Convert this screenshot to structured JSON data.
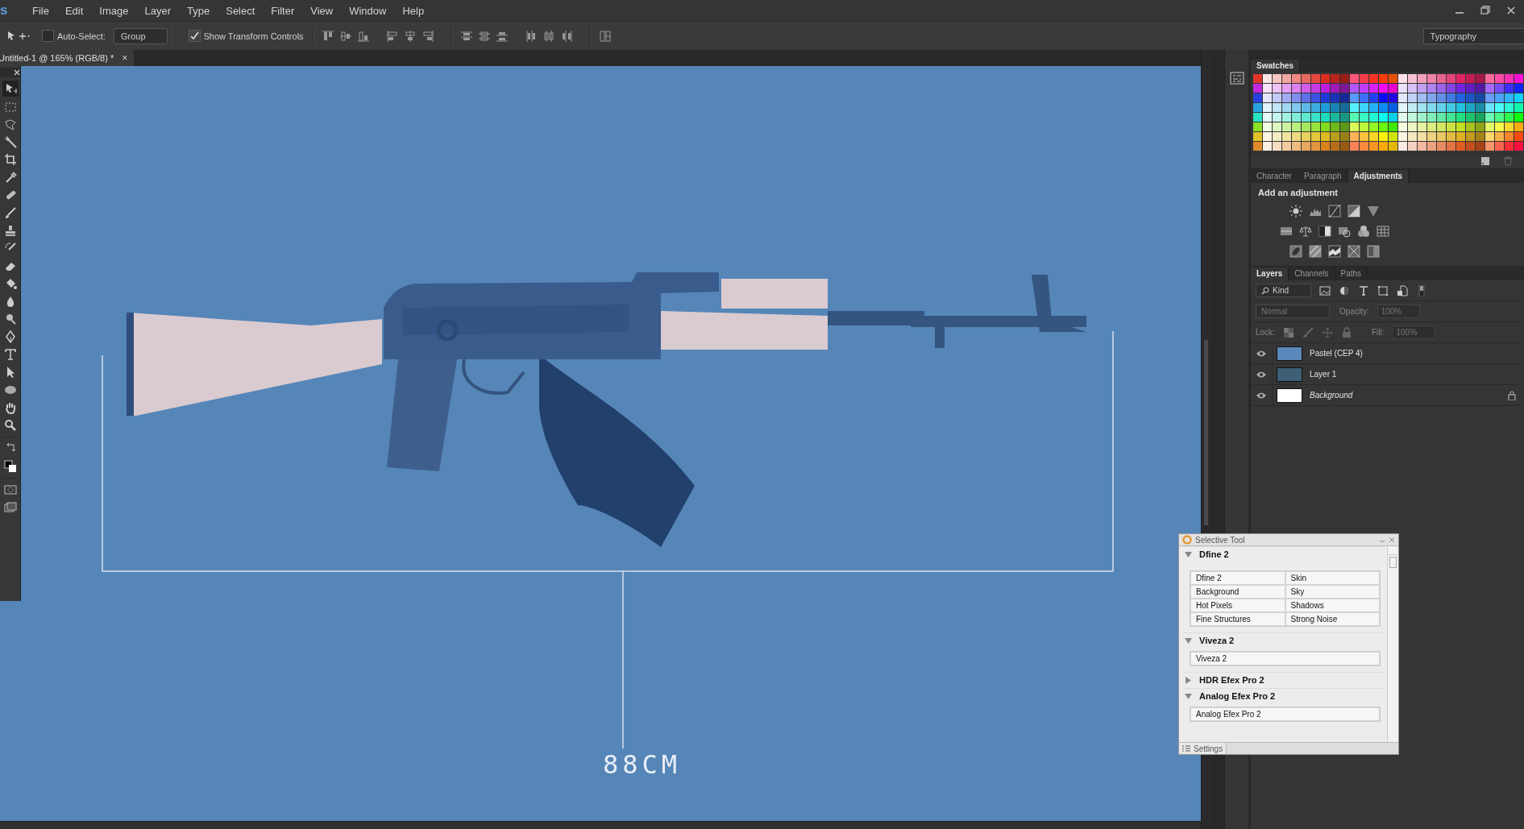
{
  "app_logo": "s",
  "menu": [
    "File",
    "Edit",
    "Image",
    "Layer",
    "Type",
    "Select",
    "Filter",
    "View",
    "Window",
    "Help"
  ],
  "options_bar": {
    "auto_select": {
      "label": "Auto-Select:",
      "checked": false
    },
    "auto_select_target": "Group",
    "show_transform_controls": {
      "label": "Show Transform Controls",
      "checked": true
    }
  },
  "workspace": "Typography",
  "document_tab": {
    "title": "Untitled-1 @ 165% (RGB/8) *",
    "close": "×"
  },
  "canvas": {
    "dimension_label": "88CM"
  },
  "swatches_panel": {
    "title": "Swatches"
  },
  "adjust_panel": {
    "tabs": [
      {
        "label": "Character",
        "selected": false
      },
      {
        "label": "Paragraph",
        "selected": false
      },
      {
        "label": "Adjustments",
        "selected": true
      }
    ],
    "heading": "Add an adjustment"
  },
  "layers_panel": {
    "tabs": [
      {
        "label": "Layers",
        "selected": true
      },
      {
        "label": "Channels",
        "selected": false
      },
      {
        "label": "Paths",
        "selected": false
      }
    ],
    "filter": "Kind",
    "blend_mode": "Normal",
    "opacity_label": "Opacity:",
    "opacity": "100%",
    "lock_label": "Lock:",
    "fill_label": "Fill:",
    "fill": "100%",
    "layers": [
      {
        "name": "Pastel (CEP 4)",
        "visible": true,
        "locked": false,
        "color": "#5a88bb"
      },
      {
        "name": "Layer 1",
        "visible": true,
        "locked": false,
        "color": "#3e5f75"
      },
      {
        "name": "Background",
        "visible": true,
        "locked": true,
        "color": "#ffffff"
      }
    ]
  },
  "selective_tool": {
    "title": "Selective Tool",
    "sections": [
      {
        "name": "Dfine 2",
        "expanded": true,
        "items": [
          "Dfine 2",
          "Skin",
          "Background",
          "Sky",
          "Hot Pixels",
          "Shadows",
          "Fine Structures",
          "Strong Noise"
        ]
      },
      {
        "name": "Viveza 2",
        "expanded": true,
        "items": [
          "Viveza 2"
        ]
      },
      {
        "name": "HDR Efex Pro 2",
        "expanded": false
      },
      {
        "name": "Analog Efex Pro 2",
        "expanded": true,
        "items": [
          "Analog Efex Pro 2"
        ]
      }
    ],
    "settings": "Settings"
  }
}
